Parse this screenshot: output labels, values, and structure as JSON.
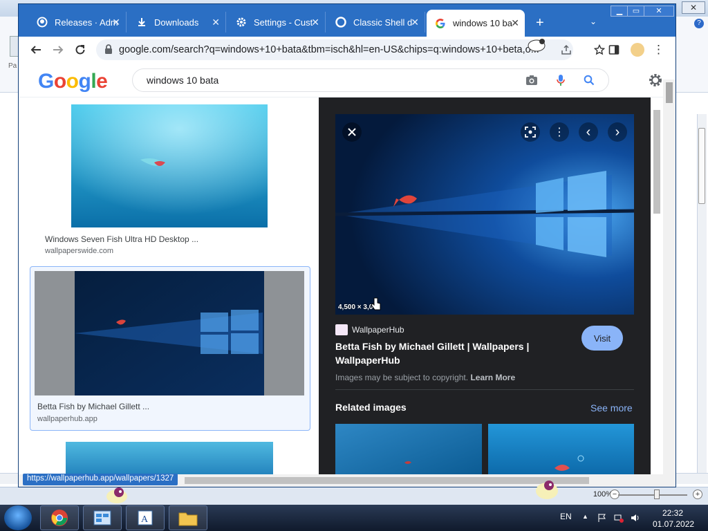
{
  "background_app": {
    "ribbon_label": "Pa",
    "zoom_level": "100%",
    "zoom_minus": "−",
    "zoom_plus": "+",
    "close_label": "✕",
    "help_label": "?"
  },
  "browser": {
    "tabs": [
      {
        "title": "Releases · Adm",
        "icon": "github-icon"
      },
      {
        "title": "Downloads",
        "icon": "download-icon"
      },
      {
        "title": "Settings - Cust",
        "icon": "gear-icon"
      },
      {
        "title": "Classic Shell d",
        "icon": "classic-shell-icon"
      },
      {
        "title": "windows 10 ba",
        "icon": "google-icon",
        "active": true
      }
    ],
    "tab_close": "✕",
    "new_tab": "+",
    "tab_menu": "⌄",
    "window_buttons": {
      "minimize": "▁",
      "maximize": "▭",
      "close": "✕"
    },
    "url": "google.com/search?q=windows+10+bata&tbm=isch&hl=en-US&chips=q:windows+10+beta,o...",
    "status_url": "https://wallpaperhub.app/wallpapers/1327"
  },
  "google": {
    "logo": [
      "G",
      "o",
      "o",
      "g",
      "l",
      "e"
    ],
    "logo_colors": [
      "#4285F4",
      "#EA4335",
      "#FBBC05",
      "#4285F4",
      "#34A853",
      "#EA4335"
    ],
    "query": "windows 10 bata",
    "results": [
      {
        "title": "Windows Seven Fish Ultra HD Desktop ...",
        "site": "wallpaperswide.com"
      },
      {
        "title": "Betta Fish by Michael Gillett ...",
        "site": "wallpaperhub.app"
      }
    ],
    "preview": {
      "dimensions": "4,500 × 3,00",
      "source": "WallpaperHub",
      "title": "Betta Fish by Michael Gillett | Wallpapers | WallpaperHub",
      "visit": "Visit",
      "copyright": "Images may be subject to copyright.",
      "learn_more": "Learn More",
      "related_title": "Related images",
      "see_more": "See more",
      "close": "✕",
      "prev": "‹",
      "next": "›",
      "more": "⋮"
    }
  },
  "taskbar": {
    "language": "EN",
    "tray_arrow": "▲",
    "time": "22:32",
    "date": "01.07.2022"
  },
  "colors": {
    "chrome_blue": "#2b6fc4",
    "preview_bg": "#202124",
    "link_blue": "#8ab4f8"
  }
}
